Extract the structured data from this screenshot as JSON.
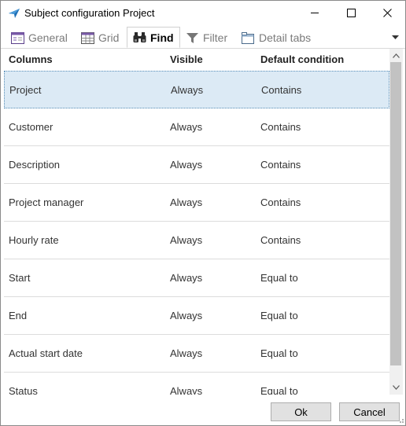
{
  "window": {
    "title": "Subject configuration Project",
    "accent_color": "#1f6fb5"
  },
  "tabs": [
    {
      "label": "General",
      "icon": "list-panel-icon",
      "active": false
    },
    {
      "label": "Grid",
      "icon": "grid-table-icon",
      "active": false
    },
    {
      "label": "Find",
      "icon": "binoculars-icon",
      "active": true
    },
    {
      "label": "Filter",
      "icon": "funnel-icon",
      "active": false
    },
    {
      "label": "Detail tabs",
      "icon": "tabbed-window-icon",
      "active": false
    }
  ],
  "grid": {
    "headers": {
      "columns": "Columns",
      "visible": "Visible",
      "default_condition": "Default condition"
    },
    "rows": [
      {
        "column": "Project",
        "visible": "Always",
        "condition": "Contains",
        "selected": true
      },
      {
        "column": "Customer",
        "visible": "Always",
        "condition": "Contains"
      },
      {
        "column": "Description",
        "visible": "Always",
        "condition": "Contains"
      },
      {
        "column": "Project manager",
        "visible": "Always",
        "condition": "Contains"
      },
      {
        "column": "Hourly rate",
        "visible": "Always",
        "condition": "Contains"
      },
      {
        "column": "Start",
        "visible": "Always",
        "condition": "Equal to"
      },
      {
        "column": "End",
        "visible": "Always",
        "condition": "Equal to"
      },
      {
        "column": "Actual start date",
        "visible": "Always",
        "condition": "Equal to"
      },
      {
        "column": "Status",
        "visible": "Always",
        "condition": "Equal to"
      }
    ],
    "selected_color": "#dceaf5"
  },
  "footer": {
    "ok_label": "Ok",
    "cancel_label": "Cancel"
  }
}
